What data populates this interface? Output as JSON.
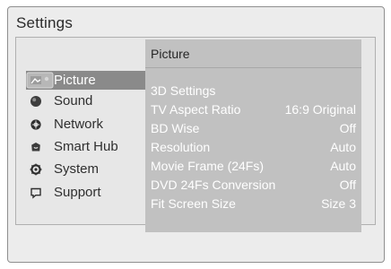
{
  "app": {
    "title": "Settings"
  },
  "sidebar": {
    "items": [
      {
        "label": "Picture",
        "icon": "picture-icon"
      },
      {
        "label": "Sound",
        "icon": "sound-icon"
      },
      {
        "label": "Network",
        "icon": "network-icon"
      },
      {
        "label": "Smart Hub",
        "icon": "smart-hub-icon"
      },
      {
        "label": "System",
        "icon": "system-gear-icon"
      },
      {
        "label": "Support",
        "icon": "support-icon"
      }
    ],
    "selected": "Picture"
  },
  "submenu": {
    "title": "Picture",
    "items": [
      {
        "label": "3D Settings",
        "value": ""
      },
      {
        "label": "TV Aspect Ratio",
        "value": "16:9 Original"
      },
      {
        "label": "BD Wise",
        "value": "Off"
      },
      {
        "label": "Resolution",
        "value": "Auto"
      },
      {
        "label": "Movie Frame (24Fs)",
        "value": "Auto"
      },
      {
        "label": "DVD 24Fs Conversion",
        "value": "Off"
      },
      {
        "label": "Fit Screen Size",
        "value": "Size 3"
      }
    ]
  },
  "colors": {
    "background": "#ececec",
    "panel": "#e7e7e7",
    "submenu": "#c1c1c1",
    "selection": "#8a8a8a",
    "text_dark": "#2f2f2f",
    "text_light": "#ffffff"
  }
}
